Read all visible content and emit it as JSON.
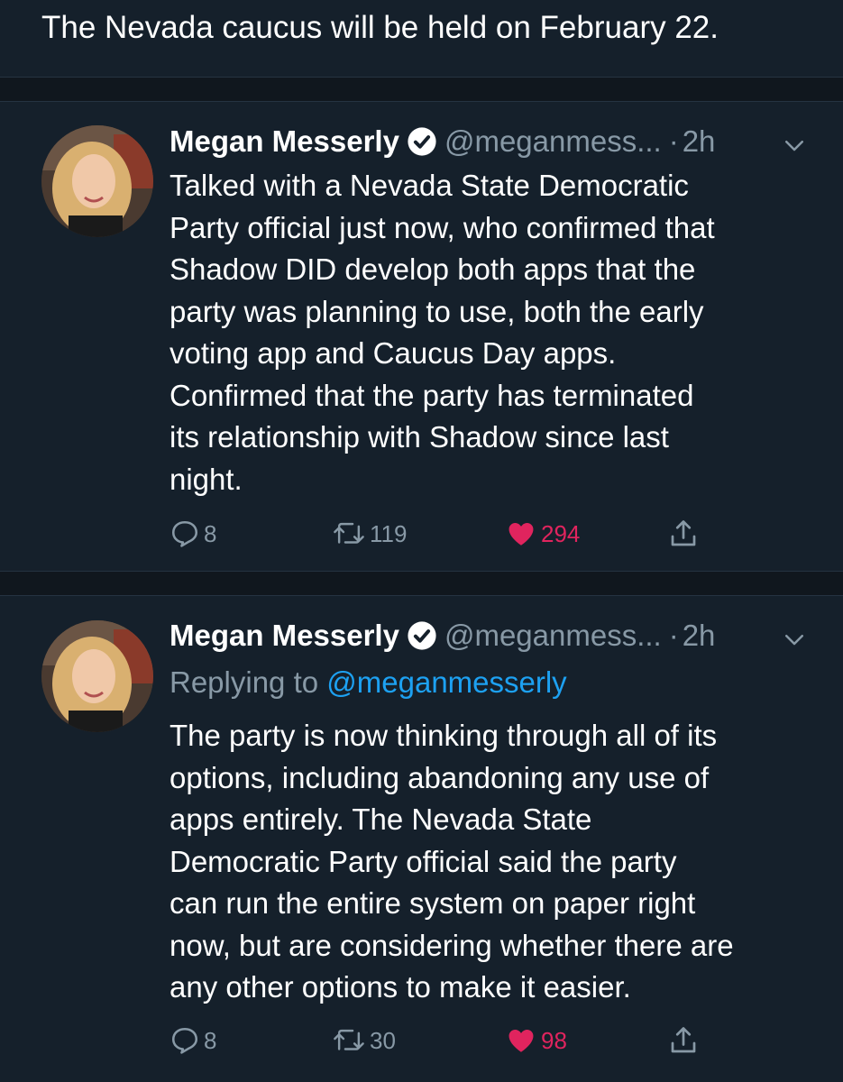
{
  "top_tweet": {
    "text": "The Nevada caucus will be held on February 22."
  },
  "tweets": [
    {
      "name": "Megan Messerly",
      "handle": "@meganmess...",
      "separator": "·",
      "time": "2h",
      "replying_prefix": "",
      "replying_handle": "",
      "text": "Talked with a Nevada State Democratic\nParty official just now, who confirmed that\nShadow DID develop both apps that the\nparty was planning to use, both the early\nvoting app and Caucus Day apps.\nConfirmed that the party has terminated\nits relationship with Shadow since last\nnight.",
      "replies": "8",
      "retweets": "119",
      "likes": "294"
    },
    {
      "name": "Megan Messerly",
      "handle": "@meganmess...",
      "separator": "·",
      "time": "2h",
      "replying_prefix": "Replying to ",
      "replying_handle": "@meganmesserly",
      "text": "The party is now thinking through all of its\noptions, including abandoning any use of\napps entirely. The Nevada State\nDemocratic Party official said the party\ncan run the entire system on paper right\nnow, but are considering whether there are\nany other options to make it easier.",
      "replies": "8",
      "retweets": "30",
      "likes": "98"
    }
  ],
  "icons": {
    "verified": "verified-badge-icon",
    "more": "chevron-down-icon",
    "reply": "reply-bubble-icon",
    "retweet": "retweet-icon",
    "like": "heart-icon",
    "share": "share-icon"
  },
  "colors": {
    "background": "#15202b",
    "divider": "#10171e",
    "secondary_text": "#8899a6",
    "link": "#1da1f2",
    "like": "#e0245e"
  }
}
